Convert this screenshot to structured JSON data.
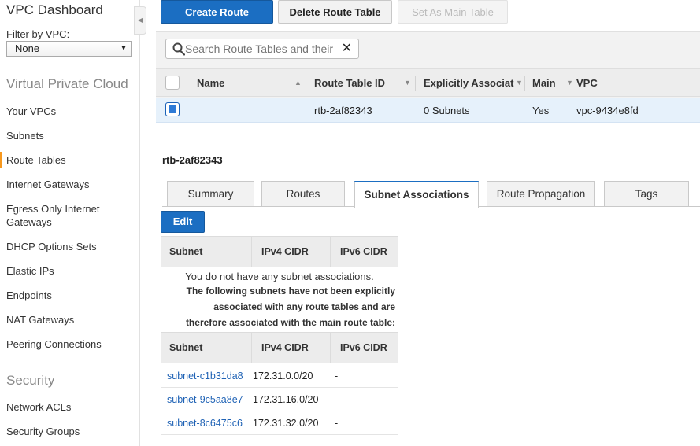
{
  "sidebar": {
    "title": "VPC Dashboard",
    "filter_label": "Filter by VPC:",
    "filter_value": "None",
    "section_vpc": "Virtual Private Cloud",
    "items": [
      {
        "label": "Your VPCs"
      },
      {
        "label": "Subnets"
      },
      {
        "label": "Route Tables",
        "active": true
      },
      {
        "label": "Internet Gateways"
      },
      {
        "label": "Egress Only Internet Gateways"
      },
      {
        "label": "DHCP Options Sets"
      },
      {
        "label": "Elastic IPs"
      },
      {
        "label": "Endpoints"
      },
      {
        "label": "NAT Gateways"
      },
      {
        "label": "Peering Connections"
      }
    ],
    "section_security": "Security",
    "security_items": [
      {
        "label": "Network ACLs"
      },
      {
        "label": "Security Groups"
      }
    ]
  },
  "toolbar": {
    "create_label": "Create Route Table",
    "delete_label": "Delete Route Table",
    "set_main_label": "Set As Main Table"
  },
  "search": {
    "placeholder": "Search Route Tables and their"
  },
  "grid": {
    "columns": [
      "Name",
      "Route Table ID",
      "Explicitly Associat",
      "Main",
      "VPC"
    ],
    "rows": [
      {
        "name": "",
        "route_table_id": "rtb-2af82343",
        "explicit": "0 Subnets",
        "main": "Yes",
        "vpc": "vpc-9434e8fd"
      }
    ]
  },
  "detail": {
    "title": "rtb-2af82343",
    "tabs": [
      "Summary",
      "Routes",
      "Subnet Associations",
      "Route Propagation",
      "Tags"
    ],
    "active_tab": "Subnet Associations",
    "edit_label": "Edit",
    "assoc_headers": [
      "Subnet",
      "IPv4 CIDR",
      "IPv6 CIDR"
    ],
    "no_assoc_msg": "You do not have any subnet associations.",
    "note_lines": [
      "The following subnets have not been explicitly",
      "associated with any route tables and are",
      "therefore associated with the main route table:"
    ],
    "subnets": [
      {
        "id": "subnet-c1b31da8",
        "ipv4": "172.31.0.0/20",
        "ipv6": "-"
      },
      {
        "id": "subnet-9c5aa8e7",
        "ipv4": "172.31.16.0/20",
        "ipv6": "-"
      },
      {
        "id": "subnet-8c6475c6",
        "ipv4": "172.31.32.0/20",
        "ipv6": "-"
      }
    ]
  },
  "colors": {
    "primary": "#1b6ec2",
    "active_accent": "#f7981d",
    "link": "#1f62b5",
    "selected_row": "#e6f1fb"
  }
}
